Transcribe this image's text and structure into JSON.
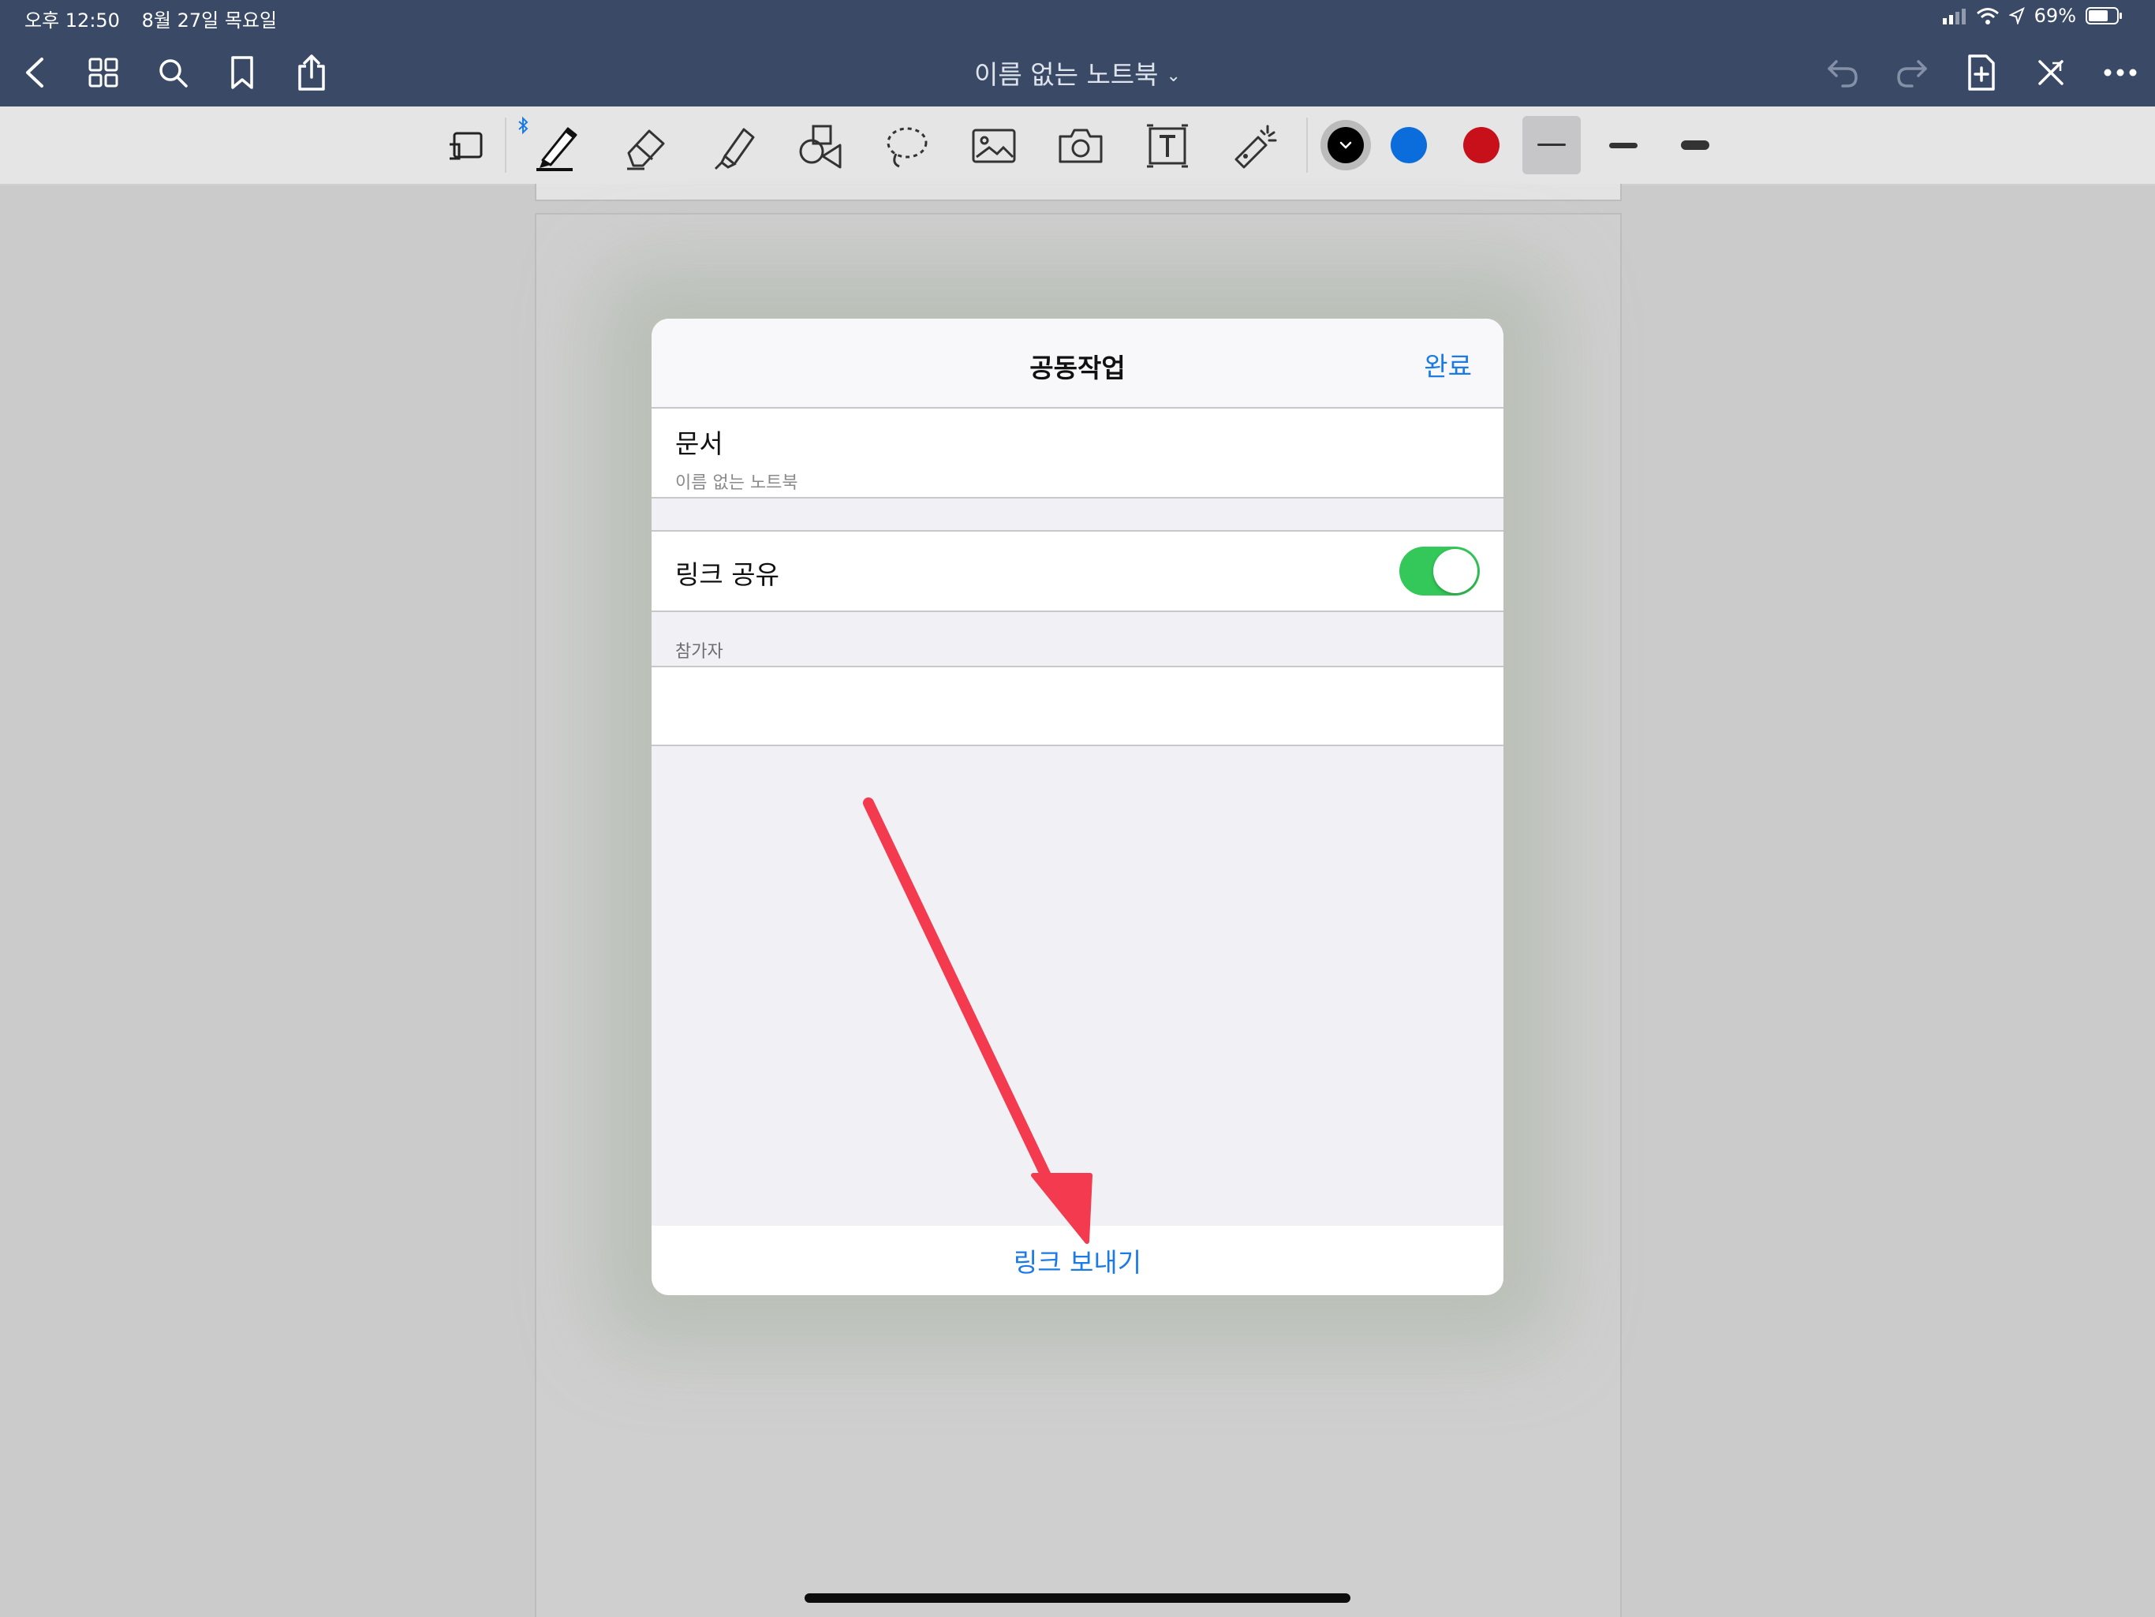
{
  "status_bar": {
    "time": "오후 12:50",
    "date": "8월 27일 목요일",
    "battery": "69%"
  },
  "nav": {
    "title": "이름 없는 노트북",
    "icons": [
      "back-icon",
      "grid-icon",
      "search-icon",
      "bookmark-icon",
      "share-icon",
      "undo-icon",
      "redo-icon",
      "add-page-icon",
      "close-icon",
      "more-icon"
    ]
  },
  "toolbar": {
    "tools": [
      "zoom-window",
      "pen",
      "eraser",
      "highlighter",
      "shapes",
      "lasso",
      "image",
      "camera",
      "text",
      "laser-pointer"
    ],
    "colors": [
      "#000000",
      "#0a6ddb",
      "#c8101a"
    ],
    "selected_color": "#000000",
    "stroke_widths": [
      "thin",
      "medium",
      "thick"
    ],
    "selected_width": "thin"
  },
  "modal": {
    "title": "공동작업",
    "done_label": "완료",
    "document": {
      "label": "문서",
      "name": "이름 없는 노트북"
    },
    "share_link": {
      "label": "링크 공유",
      "enabled": true
    },
    "participants_header": "참가자",
    "send_link_label": "링크 보내기"
  },
  "colors": {
    "nav_bg": "#3a4a66",
    "accent": "#1a7ae6",
    "toggle_on": "#34c759",
    "annotation_arrow": "#f33a4e"
  }
}
